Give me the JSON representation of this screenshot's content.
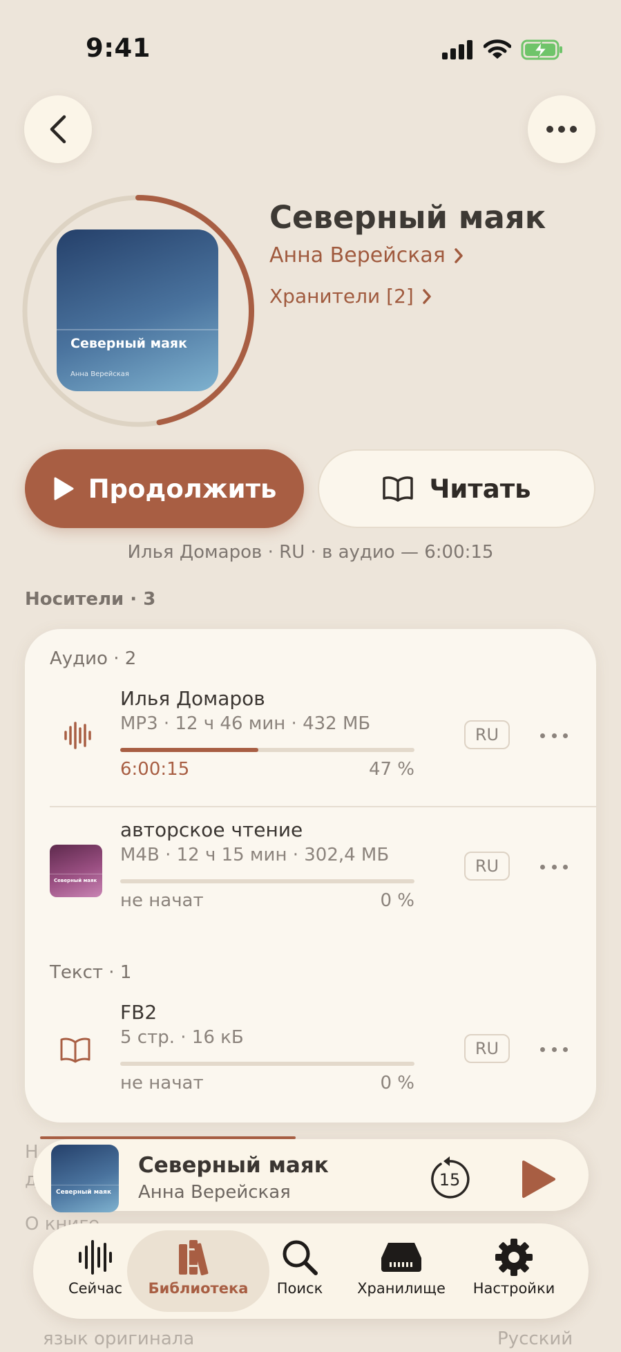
{
  "status": {
    "time": "9:41"
  },
  "book": {
    "cover_title": "Северный маяк",
    "cover_author": "Анна Верейская",
    "title": "Северный маяк",
    "author": "Анна Верейская",
    "keepers": "Хранители [2]",
    "overall_progress": 0.47
  },
  "actions": {
    "continue_label": "Продолжить",
    "read_label": "Читать"
  },
  "narrator_line": "Илья Домаров · RU · в аудио — 6:00:15",
  "media": {
    "section_title": "Носители · 3",
    "audio_group": "Аудио · 2",
    "text_group": "Текст · 1",
    "items": [
      {
        "title": "Илья Домаров",
        "meta": "MP3 · 12 ч 46 мин · 432 МБ",
        "position": "6:00:15",
        "percent": "47 %",
        "progress": 0.47,
        "lang": "RU"
      },
      {
        "title": "авторское чтение",
        "meta": "M4B · 12 ч 15 мин · 302,4 МБ",
        "position": "не начат",
        "percent": "0 %",
        "progress": 0,
        "lang": "RU",
        "thumb_title": "Северный маяк"
      },
      {
        "title": "FB2",
        "meta": "5 стр. · 16 кБ",
        "position": "не начат",
        "percent": "0 %",
        "progress": 0,
        "lang": "RU"
      }
    ]
  },
  "below": {
    "about": "О книге",
    "original_language_label": "язык оригинала",
    "original_language_value": "Русский"
  },
  "mini_player": {
    "title": "Северный маяк",
    "author": "Анна Верейская",
    "skip_seconds": "15",
    "cover_title": "Северный маяк"
  },
  "tabs": [
    {
      "label": "Сейчас",
      "icon": "waveform-icon"
    },
    {
      "label": "Библиотека",
      "icon": "books-icon",
      "active": true
    },
    {
      "label": "Поиск",
      "icon": "search-icon"
    },
    {
      "label": "Хранилище",
      "icon": "storage-icon"
    },
    {
      "label": "Настройки",
      "icon": "gear-icon"
    }
  ],
  "colors": {
    "accent": "#a85e43",
    "background": "#ede5da",
    "card": "#fbf7ef"
  }
}
